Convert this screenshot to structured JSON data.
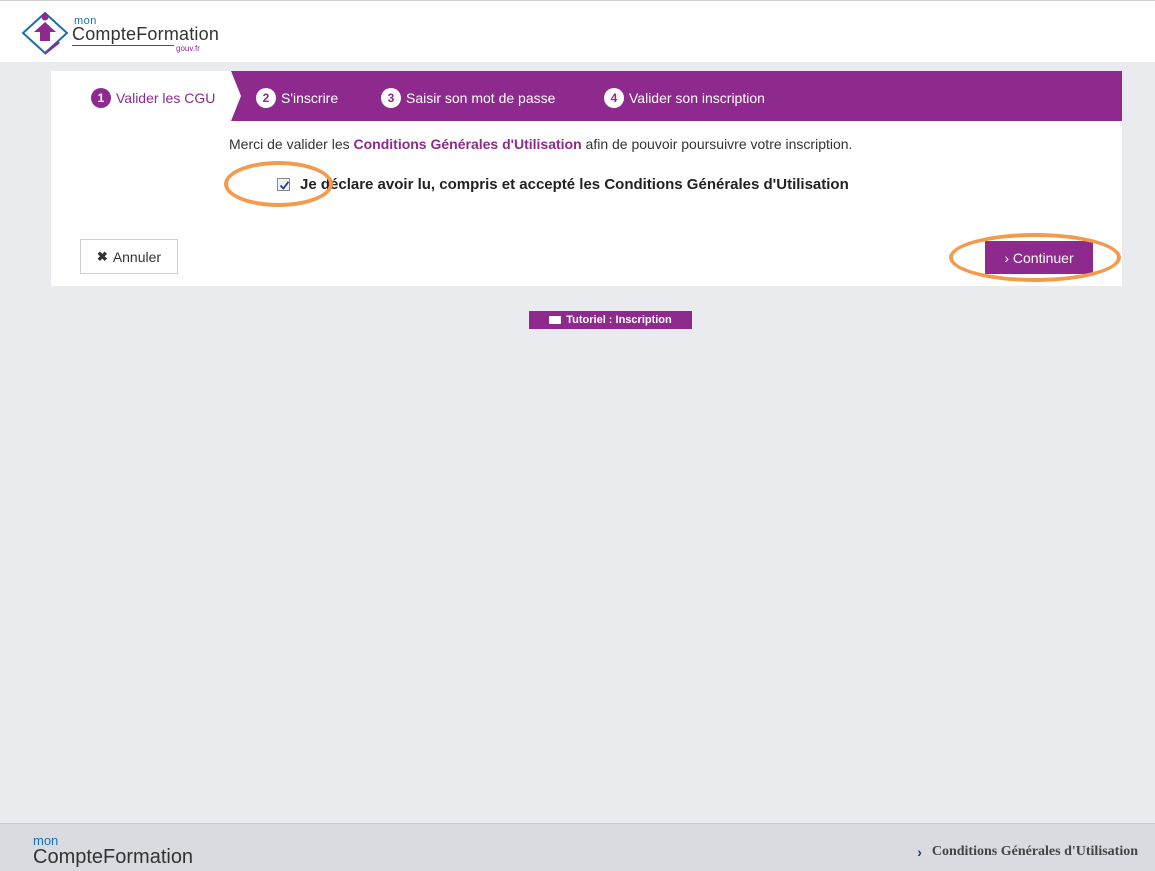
{
  "header": {
    "logo_mon": "mon",
    "logo_name": "CompteFormation",
    "logo_gouv": "gouv.fr"
  },
  "steps": [
    {
      "number": "1",
      "label": "Valider les CGU",
      "active": true
    },
    {
      "number": "2",
      "label": "S'inscrire",
      "active": false
    },
    {
      "number": "3",
      "label": "Saisir son mot de passe",
      "active": false
    },
    {
      "number": "4",
      "label": "Valider son inscription",
      "active": false
    }
  ],
  "main": {
    "intro_before": "Merci de valider les ",
    "intro_link": "Conditions Générales d'Utilisation",
    "intro_after": " afin de pouvoir poursuivre votre inscription.",
    "checkbox_label": "Je déclare avoir lu, compris et accepté les Conditions Générales d'Utilisation",
    "checkbox_checked": true,
    "cancel_label": "Annuler",
    "continue_label": "› Continuer"
  },
  "tutorial_label": "Tutoriel : Inscription",
  "footer": {
    "mon": "mon",
    "name": "CompteFormation",
    "link_label": "Conditions Générales d'Utilisation"
  },
  "colors": {
    "accent": "#8e2a8e",
    "annotation": "#f29b4c",
    "background": "#e9ebef"
  }
}
